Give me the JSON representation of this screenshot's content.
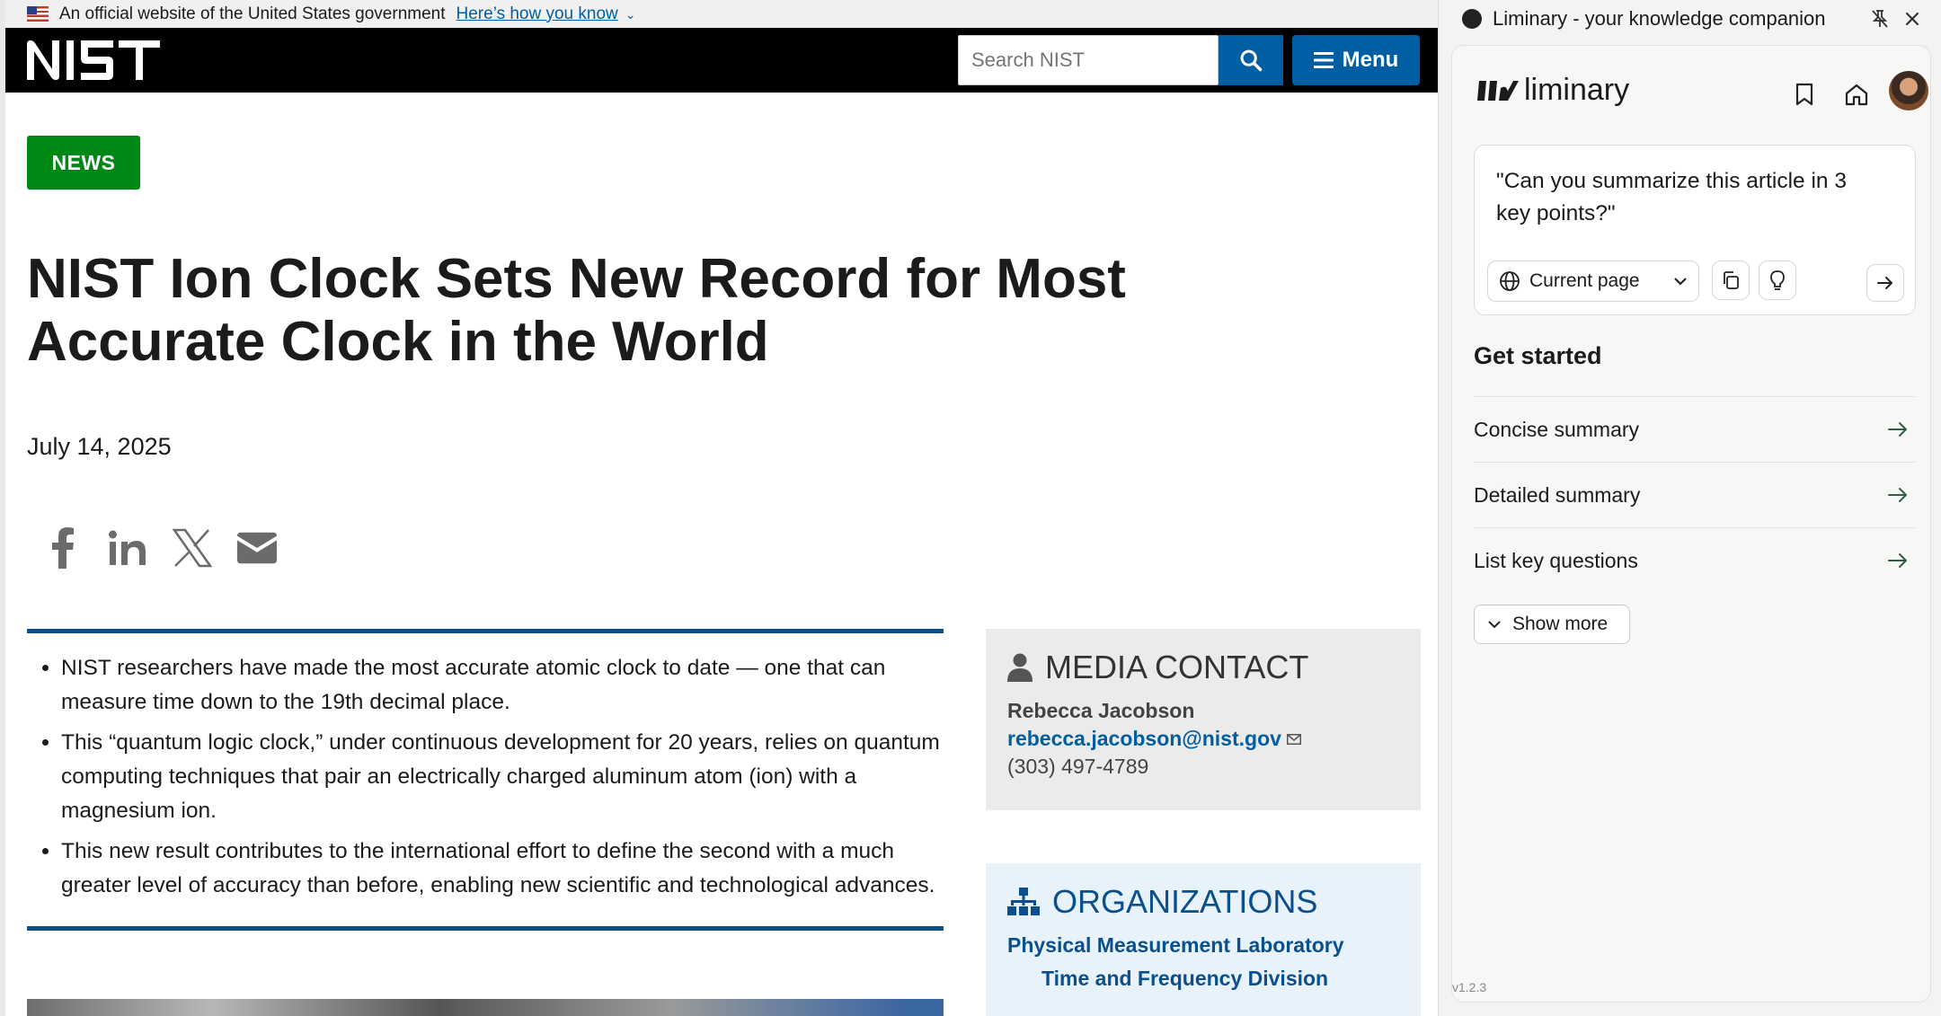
{
  "gov_banner": {
    "text": "An official website of the United States government",
    "link": "Here’s how you know"
  },
  "header": {
    "logo_alt": "NIST",
    "search_placeholder": "Search NIST",
    "menu_label": "Menu"
  },
  "article": {
    "tag": "NEWS",
    "title": "NIST Ion Clock Sets New Record for Most Accurate Clock in the World",
    "date": "July 14, 2025",
    "share_icons": [
      "facebook-icon",
      "linkedin-icon",
      "x-icon",
      "email-icon"
    ],
    "highlights": [
      "NIST researchers have made the most accurate atomic clock to date — one that can measure time down to the 19th decimal place.",
      "This “quantum logic clock,” under continuous development for 20 years, relies on quantum computing techniques that pair an electrically charged aluminum atom (ion) with a magnesium ion.",
      "This new result contributes to the international effort to define the second with a much greater level of accuracy than before, enabling new scientific and technological advances."
    ]
  },
  "media_contact": {
    "heading": "MEDIA CONTACT",
    "name": "Rebecca Jacobson",
    "email": "rebecca.jacobson@nist.gov",
    "phone": "(303) 497-4789"
  },
  "organizations": {
    "heading": "ORGANIZATIONS",
    "items": [
      "Physical Measurement Laboratory",
      "Time and Frequency Division"
    ]
  },
  "panel": {
    "window_title": "Liminary - your knowledge companion",
    "brand": "liminary",
    "prompt": "\"Can you summarize this article in 3 key points?\"",
    "scope": "Current page",
    "get_started": "Get started",
    "actions": [
      "Concise summary",
      "Detailed summary",
      "List key questions"
    ],
    "show_more": "Show more",
    "version": "v1.2.3"
  },
  "colors": {
    "nist_blue": "#005ea2",
    "news_green": "#008817",
    "rule_blue": "#0b4f8c"
  }
}
